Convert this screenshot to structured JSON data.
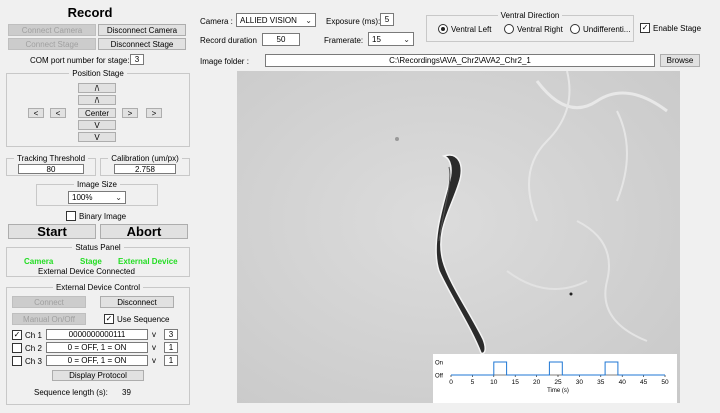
{
  "record": {
    "title": "Record",
    "connect_camera": "Connect Camera",
    "disconnect_camera": "Disconnect Camera",
    "connect_stage": "Connect Stage",
    "disconnect_stage": "Disconnect Stage",
    "com_label": "COM port number for stage:",
    "com_value": "3"
  },
  "position_stage": {
    "title": "Position Stage",
    "up1": "/\\",
    "up2": "/\\",
    "left1": "<",
    "left2": "<",
    "center": "Center",
    "right1": ">",
    "right2": ">",
    "down1": "V",
    "down2": "V"
  },
  "tracking": {
    "title": "Tracking Threshold",
    "value": "80"
  },
  "calibration": {
    "title": "Calibration (um/px)",
    "value": "2.758"
  },
  "image_size": {
    "title": "Image Size",
    "value": "100%"
  },
  "binary_image": {
    "label": "Binary Image",
    "checked": false
  },
  "actions": {
    "start": "Start",
    "abort": "Abort"
  },
  "status_panel": {
    "title": "Status Panel",
    "camera": "Camera",
    "stage": "Stage",
    "external": "External Device",
    "message": "External Device Connected",
    "color_ok": "#22dd22"
  },
  "external_control": {
    "title": "External Device Control",
    "connect": "Connect",
    "disconnect": "Disconnect",
    "manual": "Manual On/Off",
    "use_sequence": "Use Sequence",
    "use_sequence_checked": "✓",
    "channels": [
      {
        "label": "Ch 1",
        "check": "✓",
        "value": "0000000000111",
        "chev": "v",
        "num": "3"
      },
      {
        "label": "Ch 2",
        "check": "",
        "value": "0 = OFF, 1 = ON",
        "chev": "v",
        "num": "1"
      },
      {
        "label": "Ch 3",
        "check": "",
        "value": "0 = OFF, 1 = ON",
        "chev": "v",
        "num": "1"
      }
    ],
    "display_protocol": "Display Protocol",
    "sequence_label": "Sequence length (s):",
    "sequence_value": "39"
  },
  "top": {
    "camera_label": "Camera :",
    "camera_value": "ALLIED VISION",
    "exposure_label": "Exposure (ms):",
    "exposure_value": "5",
    "duration_label": "Record duration",
    "duration_value": "50",
    "framerate_label": "Framerate:",
    "framerate_value": "15",
    "ventral_title": "Ventral Direction",
    "ventral_left": "Ventral Left",
    "ventral_right": "Ventral Right",
    "ventral_und": "Undifferenti...",
    "enable_stage": "Enable Stage",
    "enable_stage_check": "✓",
    "folder_label": "Image folder :",
    "folder_value": "C:\\Recordings\\AVA_Chr2\\AVA2_Chr2_1",
    "browse": "Browse"
  },
  "chart_data": {
    "type": "line",
    "xlabel": "Time (s)",
    "ylabel": "",
    "y_tick_labels": [
      "Off",
      "On"
    ],
    "x_ticks": [
      0,
      5,
      10,
      15,
      20,
      25,
      30,
      35,
      40,
      45,
      50
    ],
    "xlim": [
      0,
      50
    ],
    "ylim": [
      0,
      1
    ],
    "series": [
      {
        "color": "#1f77d4",
        "points": [
          [
            0,
            0
          ],
          [
            10,
            0
          ],
          [
            10,
            1
          ],
          [
            13,
            1
          ],
          [
            13,
            0
          ],
          [
            23,
            0
          ],
          [
            23,
            1
          ],
          [
            26,
            1
          ],
          [
            26,
            0
          ],
          [
            36,
            0
          ],
          [
            36,
            1
          ],
          [
            39,
            1
          ],
          [
            39,
            0
          ],
          [
            50,
            0
          ]
        ]
      }
    ]
  }
}
